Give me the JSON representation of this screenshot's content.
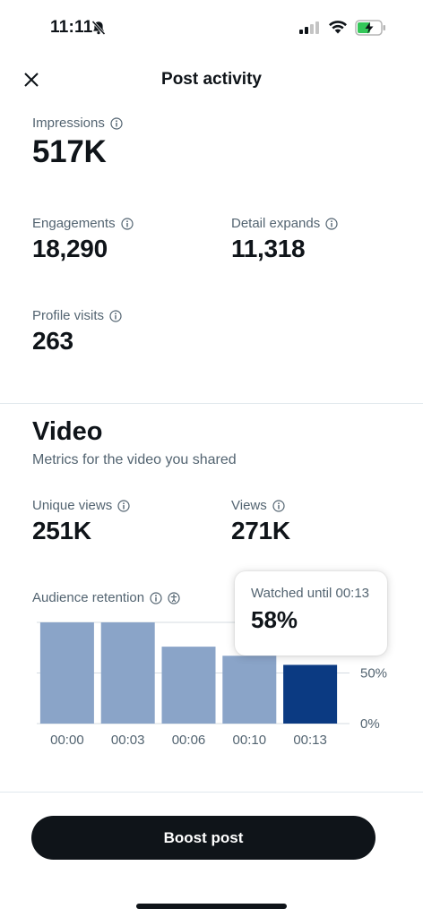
{
  "status_bar": {
    "time": "11:11"
  },
  "header": {
    "title": "Post activity"
  },
  "metrics": {
    "impressions": {
      "label": "Impressions",
      "value": "517K"
    },
    "engagements": {
      "label": "Engagements",
      "value": "18,290"
    },
    "detail_expands": {
      "label": "Detail expands",
      "value": "11,318"
    },
    "profile_visits": {
      "label": "Profile visits",
      "value": "263"
    }
  },
  "video": {
    "title": "Video",
    "subtitle": "Metrics for the video you shared",
    "unique_views": {
      "label": "Unique views",
      "value": "251K"
    },
    "views": {
      "label": "Views",
      "value": "271K"
    }
  },
  "retention": {
    "label": "Audience retention",
    "tooltip": {
      "caption": "Watched until 00:13",
      "value": "58%"
    }
  },
  "chart_data": {
    "type": "bar",
    "categories": [
      "00:00",
      "00:03",
      "00:06",
      "00:10",
      "00:13"
    ],
    "values": [
      100,
      100,
      76,
      67,
      58
    ],
    "highlighted_index": 4,
    "y_tick_labels": [
      "0%",
      "50%"
    ],
    "ylim": [
      0,
      100
    ],
    "grid": true,
    "colors": {
      "bar": "#8aa4c8",
      "highlight": "#0b3a82"
    }
  },
  "actions": {
    "boost_label": "Boost post"
  }
}
